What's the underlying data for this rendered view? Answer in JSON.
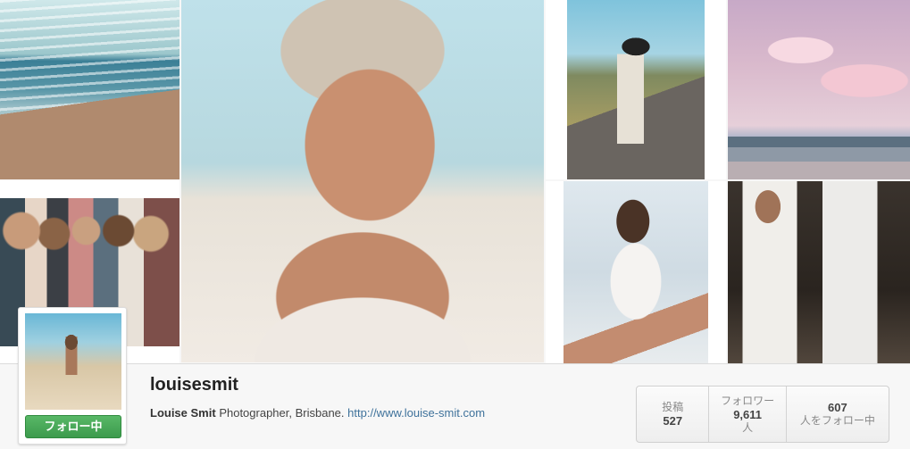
{
  "profile": {
    "username": "louisesmit",
    "full_name": "Louise Smit",
    "bio": "Photographer, Brisbane.",
    "website": "http://www.louise-smit.com",
    "follow_button": "フォロー中"
  },
  "stats": {
    "posts_label": "投稿",
    "posts_value": "527",
    "followers_label": "フォロワー",
    "followers_value": "9,611",
    "followers_suffix": "人",
    "following_value": "607",
    "following_label": "人をフォロー中"
  },
  "colors": {
    "follow_green": "#3c9a4c",
    "link_blue": "#3f729b"
  }
}
